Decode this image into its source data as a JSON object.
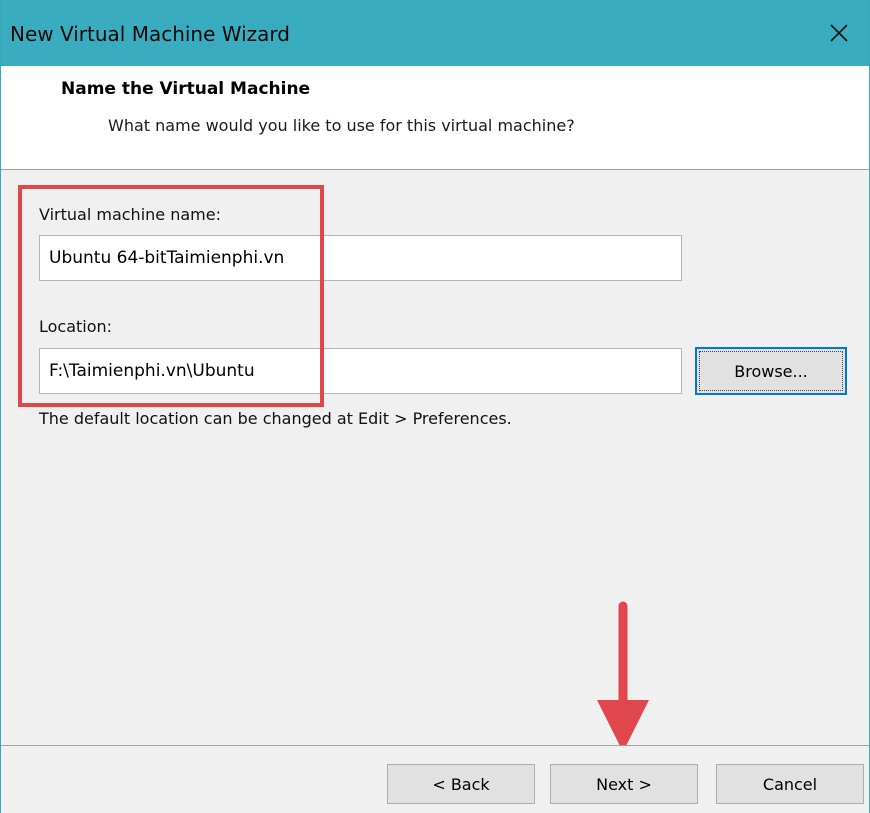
{
  "window": {
    "title": "New Virtual Machine Wizard"
  },
  "header": {
    "title": "Name the Virtual Machine",
    "subtitle": "What name would you like to use for this virtual machine?"
  },
  "form": {
    "vm_name_label": "Virtual machine name:",
    "vm_name_value": "Ubuntu 64-bitTaimienphi.vn",
    "location_label": "Location:",
    "location_value": "F:\\Taimienphi.vn\\Ubuntu",
    "browse_label": "Browse...",
    "hint": "The default location can be changed at Edit > Preferences."
  },
  "footer": {
    "back_label": "< Back",
    "next_label": "Next >",
    "cancel_label": "Cancel"
  },
  "icons": {
    "close": "close-icon",
    "annotation": "arrow-down-icon"
  },
  "colors": {
    "titlebar": "#3aacbf",
    "highlight": "#e0474c",
    "focus": "#0078d7"
  }
}
